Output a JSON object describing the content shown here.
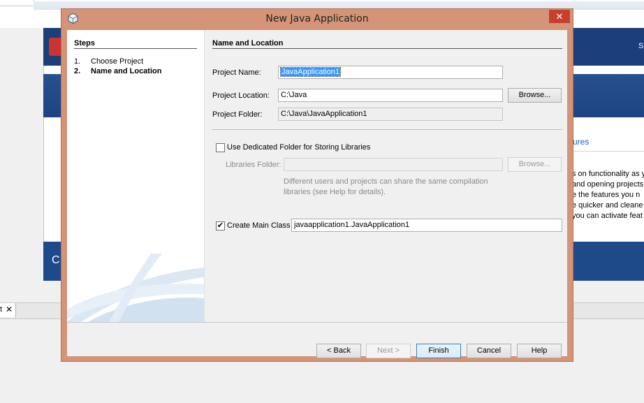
{
  "background": {
    "header_letter": "S",
    "link_text": "ures",
    "text_lines": [
      "s on functionality as y",
      "and opening projects",
      "e the features you n",
      "e quicker and cleane",
      "you can activate feat"
    ],
    "band_letter": "C",
    "tab_text": "t",
    "tab_close": "✕"
  },
  "dialog": {
    "title": "New Java Application",
    "close_glyph": "✕",
    "steps": {
      "title": "Steps",
      "items": [
        {
          "num": "1.",
          "label": "Choose Project"
        },
        {
          "num": "2.",
          "label": "Name and Location"
        }
      ]
    },
    "panel": {
      "title": "Name and Location",
      "project_name_label": "Project Name:",
      "project_name_value": "JavaApplication1",
      "project_location_label": "Project Location:",
      "project_location_value": "C:\\Java",
      "browse_label": "Browse...",
      "project_folder_label": "Project Folder:",
      "project_folder_value": "C:\\Java\\JavaApplication1",
      "dedicated_folder_label": "Use Dedicated Folder for Storing Libraries",
      "dedicated_folder_checked": false,
      "libraries_folder_label": "Libraries Folder:",
      "libraries_folder_value": "",
      "libraries_browse_label": "Browse...",
      "libraries_help_line1": "Different users and projects can share the same compilation",
      "libraries_help_line2": "libraries (see Help for details).",
      "create_main_label": "Create Main Class",
      "create_main_checked": true,
      "create_main_check_glyph": "✔",
      "main_class_value": "javaapplication1.JavaApplication1"
    },
    "buttons": {
      "back": "< Back",
      "next": "Next >",
      "finish": "Finish",
      "cancel": "Cancel",
      "help": "Help"
    }
  },
  "colors": {
    "title_bar": "#d49478",
    "close_button": "#c7402e",
    "selection": "#3399ff"
  }
}
